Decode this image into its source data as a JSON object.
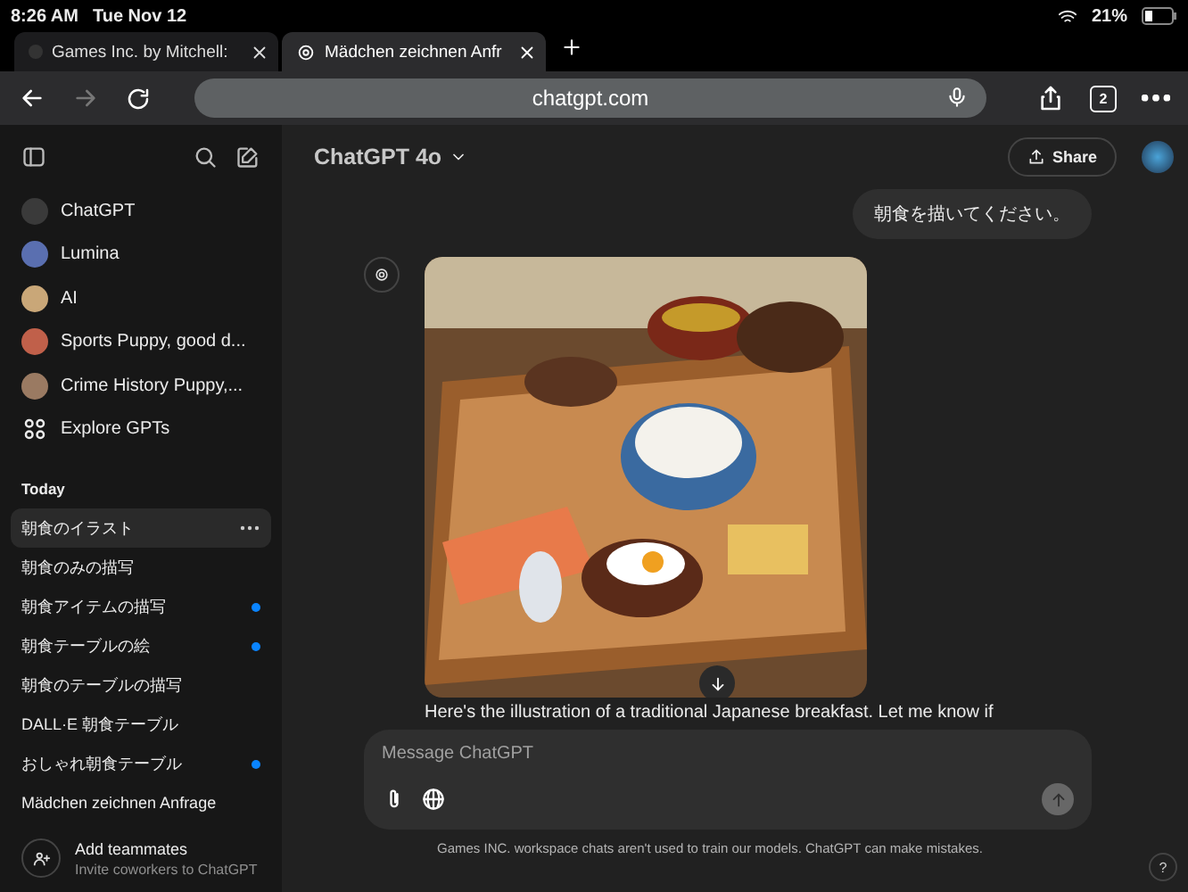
{
  "status_bar": {
    "time": "8:26 AM",
    "date": "Tue Nov 12",
    "battery": "21%"
  },
  "browser_tabs": [
    {
      "title": "Games Inc. by Mitchell:",
      "selected": false
    },
    {
      "title": "Mädchen zeichnen Anfr",
      "selected": true
    }
  ],
  "address_bar": {
    "url": "chatgpt.com",
    "tab_count": "2"
  },
  "sidebar": {
    "gpts": [
      {
        "label": "ChatGPT",
        "kind": "gpt",
        "color": "#3a3a3a"
      },
      {
        "label": "Lumina",
        "kind": "gpt",
        "color": "#5a6fb0"
      },
      {
        "label": "AI",
        "kind": "gpt",
        "color": "#c9a778"
      },
      {
        "label": "Sports Puppy, good d...",
        "kind": "gpt",
        "color": "#c0604a"
      },
      {
        "label": "Crime History Puppy,...",
        "kind": "gpt",
        "color": "#9a7a62"
      },
      {
        "label": "Explore GPTs",
        "kind": "explore"
      }
    ],
    "section_title": "Today",
    "chats": [
      {
        "title": "朝食のイラスト",
        "selected": true,
        "unread": false
      },
      {
        "title": "朝食のみの描写",
        "selected": false,
        "unread": false
      },
      {
        "title": "朝食アイテムの描写",
        "selected": false,
        "unread": true
      },
      {
        "title": "朝食テーブルの絵",
        "selected": false,
        "unread": true
      },
      {
        "title": "朝食のテーブルの描写",
        "selected": false,
        "unread": false
      },
      {
        "title": "DALL·E 朝食テーブル",
        "selected": false,
        "unread": false
      },
      {
        "title": "おしゃれ朝食テーブル",
        "selected": false,
        "unread": true
      },
      {
        "title": "Mädchen zeichnen Anfrage",
        "selected": false,
        "unread": false
      }
    ],
    "footer": {
      "title": "Add teammates",
      "subtitle": "Invite coworkers to ChatGPT"
    }
  },
  "chat": {
    "model": "ChatGPT 4o",
    "share": "Share",
    "user_message": "朝食を描いてください。",
    "assistant_text": "Here's the illustration of a traditional Japanese breakfast. Let me know if",
    "composer": {
      "placeholder": "Message ChatGPT"
    },
    "disclaimer": "Games INC. workspace chats aren't used to train our models. ChatGPT can make mistakes.",
    "help": "?"
  }
}
